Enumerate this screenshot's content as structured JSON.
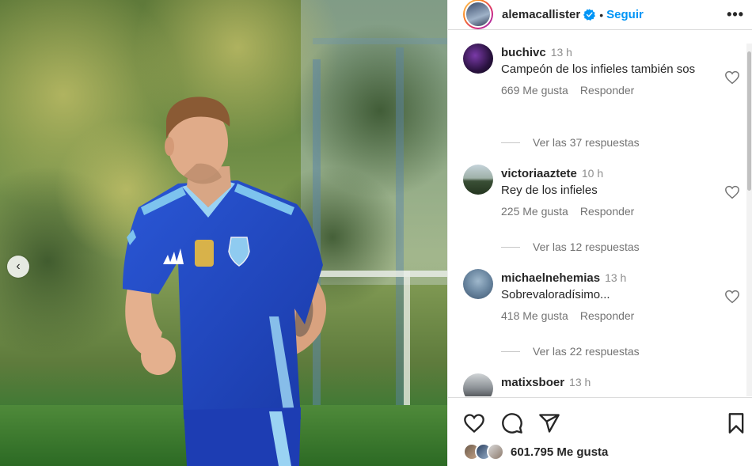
{
  "post": {
    "username": "alemacallister",
    "follow_label": "Seguir",
    "verified_icon": "verified-badge-icon",
    "more_icon": "more-options-icon"
  },
  "photo": {
    "prev_icon": "chevron-left-icon"
  },
  "comments": [
    {
      "user": "buchivc",
      "time": "13 h",
      "text": "Campeón de los infieles también sos",
      "likes": "669 Me gusta",
      "reply_label": "Responder",
      "replies": "Ver las 37 respuestas"
    },
    {
      "user": "victoriaaztete",
      "time": "10 h",
      "text": "Rey de los infieles",
      "likes": "225 Me gusta",
      "reply_label": "Responder",
      "replies": "Ver las 12 respuestas"
    },
    {
      "user": "michaelnehemias",
      "time": "13 h",
      "text": "Sobrevaloradísimo...",
      "likes": "418 Me gusta",
      "reply_label": "Responder",
      "replies": "Ver las 22 respuestas"
    },
    {
      "user": "matixsboer",
      "time": "13 h",
      "text": ""
    }
  ],
  "footer": {
    "likes_count": "601.795 Me gusta",
    "icons": [
      "heart-icon",
      "comment-icon",
      "share-icon",
      "bookmark-icon"
    ]
  },
  "colors": {
    "follow_blue": "#0095f6",
    "verified_blue": "#0095f6",
    "jersey_blue": "#1f49c4"
  }
}
